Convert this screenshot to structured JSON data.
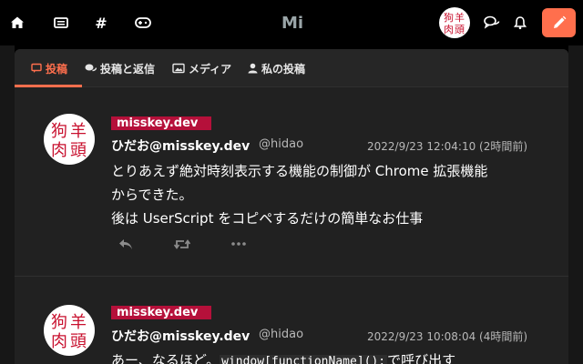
{
  "app": {
    "logo": "Mi",
    "accent": "#ff6f4d",
    "badge_color": "#b5103a"
  },
  "nav": {
    "icons": [
      "home-icon",
      "timeline-icon",
      "hashtag-icon",
      "gamepad-icon",
      "chat-icon",
      "bell-icon",
      "pencil-icon"
    ]
  },
  "tabs": [
    {
      "label": "投稿",
      "icon": "comment-icon",
      "active": true
    },
    {
      "label": "投稿と返信",
      "icon": "comments-icon",
      "active": false
    },
    {
      "label": "メディア",
      "icon": "images-icon",
      "active": false
    },
    {
      "label": "私の投稿",
      "icon": "user-icon",
      "active": false
    }
  ],
  "notes": [
    {
      "instance": "misskey.dev",
      "display_name": "ひだお@misskey.dev",
      "username": "@hidao",
      "timestamp": "2022/9/23 12:04:10 (2時間前)",
      "lines": [
        "とりあえず絶対時刻表示する機能の制御が Chrome 拡張機能",
        "からできた。",
        "後は UserScript をコピペするだけの簡単なお仕事"
      ]
    },
    {
      "instance": "misskey.dev",
      "display_name": "ひだお@misskey.dev",
      "username": "@hidao",
      "timestamp": "2022/9/23 10:08:04 (4時間前)",
      "text_before": "あー、なるほど。",
      "code": "window[functionName]();",
      "text_after": "で呼び出す"
    }
  ],
  "avatar_glyphs": [
    "狗",
    "羊",
    "肉",
    "頭"
  ]
}
